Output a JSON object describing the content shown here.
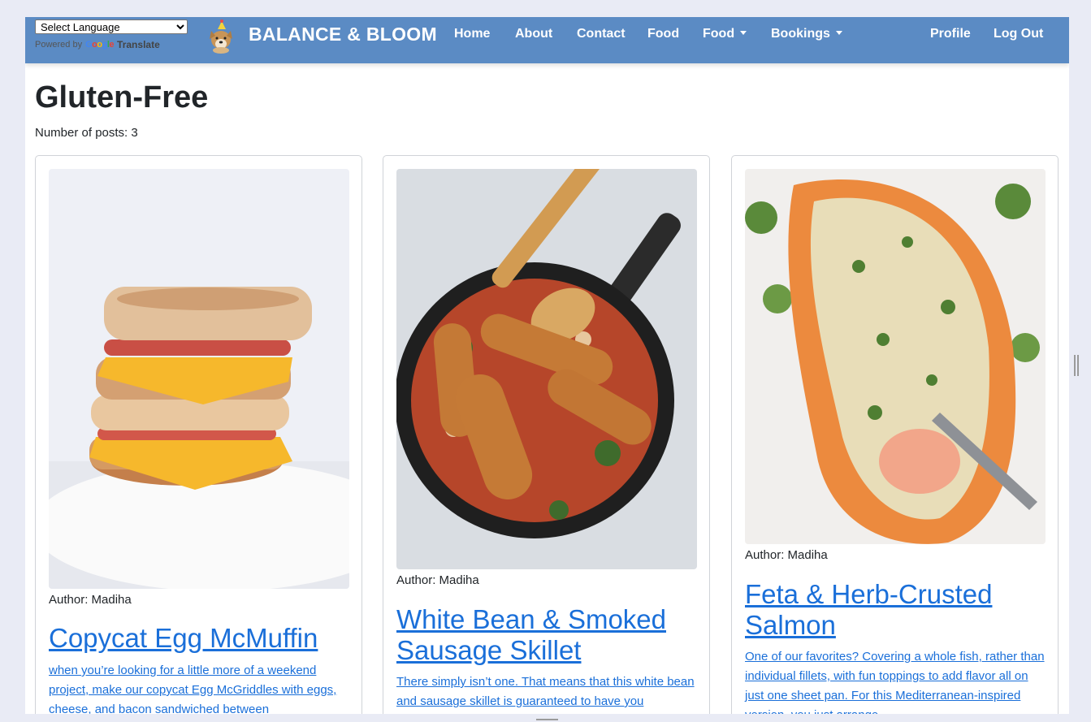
{
  "translate": {
    "select_label": "Select Language",
    "powered_by": "Powered by",
    "google": "Google",
    "translate": "Translate"
  },
  "brand": {
    "name": "BALANCE & BLOOM",
    "logo_icon": "dog-with-party-hat-icon"
  },
  "nav": {
    "left": [
      "Home",
      "About",
      "Contact",
      "Food"
    ],
    "dropdowns": [
      "Food",
      "Bookings"
    ],
    "right": [
      "Profile",
      "Log Out"
    ],
    "background": "#5b8bc4"
  },
  "page": {
    "title": "Gluten-Free",
    "post_count": "Number of posts: 3"
  },
  "link_color": "#1a6fd9",
  "posts": [
    {
      "author": "Author: Madiha",
      "title": "Copycat Egg McMuffin",
      "excerpt": "when you’re looking for a little more of a weekend project, make our copycat Egg McGriddles with eggs, cheese, and bacon sandwiched between",
      "image_icon": "egg-muffin-sandwich-photo"
    },
    {
      "author": "Author: Madiha",
      "title": "White Bean & Smoked Sausage Skillet",
      "excerpt": "There simply isn’t one. That means that this white bean and sausage skillet is guaranteed to have you",
      "image_icon": "sausage-skillet-photo"
    },
    {
      "author": "Author: Madiha",
      "title": "Feta & Herb-Crusted Salmon",
      "excerpt": "One of our favorites? Covering a whole fish, rather than individual fillets, with fun toppings to add flavor all on just one sheet pan. For this Mediterranean-inspired version, you just arrange",
      "image_icon": "herb-crusted-salmon-photo"
    }
  ]
}
